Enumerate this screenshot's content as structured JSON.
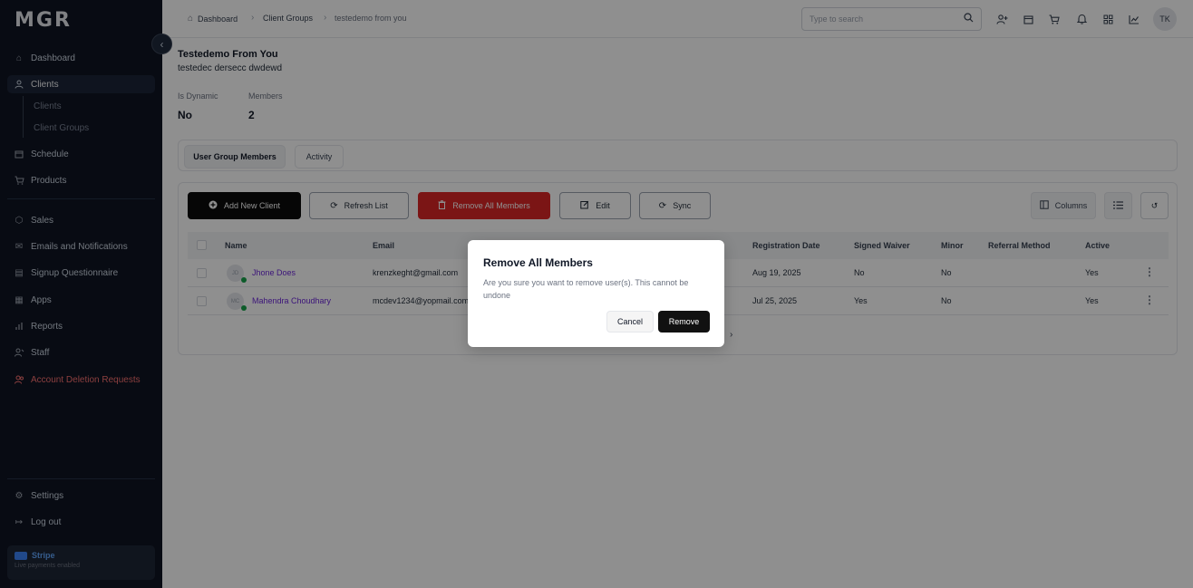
{
  "app": {
    "logo": "MGR"
  },
  "sidebar": {
    "items": [
      {
        "label": "Dashboard",
        "icon": "home-icon"
      },
      {
        "label": "Clients",
        "icon": "user-icon"
      },
      {
        "label": "Schedule",
        "icon": "calendar-icon"
      },
      {
        "label": "Products",
        "icon": "cart-icon"
      },
      {
        "label": "Sales",
        "icon": "box-icon"
      },
      {
        "label": "Emails and Notifications",
        "icon": "mail-icon"
      },
      {
        "label": "Signup Questionnaire",
        "icon": "form-icon"
      },
      {
        "label": "Apps",
        "icon": "apps-icon"
      },
      {
        "label": "Reports",
        "icon": "bar-chart-icon"
      },
      {
        "label": "Staff",
        "icon": "staff-icon"
      },
      {
        "label": "Account Deletion Requests",
        "icon": "users-icon"
      }
    ],
    "sub_items": [
      "Clients",
      "Client Groups"
    ],
    "bottom": [
      {
        "label": "Settings",
        "icon": "gear-icon"
      },
      {
        "label": "Log out",
        "icon": "logout-icon"
      }
    ],
    "stripe": {
      "title": "Stripe",
      "subtitle": "Live payments enabled"
    }
  },
  "topbar": {
    "breadcrumb": [
      "Dashboard",
      "Client Groups",
      "testedemo from you"
    ],
    "search_placeholder": "Type to search",
    "avatar_initials": "TK"
  },
  "group": {
    "title": "Testedemo From You",
    "description": "testedec dersecc dwdewd",
    "stats": [
      {
        "label": "Is Dynamic",
        "value": "No"
      },
      {
        "label": "Members",
        "value": "2"
      }
    ]
  },
  "tabs": [
    "User Group Members",
    "Activity"
  ],
  "toolbar": {
    "add": "Add New Client",
    "refresh": "Refresh List",
    "remove_all": "Remove All Members",
    "edit": "Edit",
    "sync": "Sync",
    "columns": "Columns"
  },
  "table": {
    "headers": [
      "Name",
      "Email",
      "Registration Date",
      "Signed Waiver",
      "Minor",
      "Referral Method",
      "Active"
    ],
    "rows": [
      {
        "initials": "JD",
        "name": "Jhone Does",
        "email": "krenzkeght@gmail.com",
        "registration": "Aug 19, 2025",
        "waiver": "No",
        "minor": "No",
        "referral": "",
        "active": "Yes"
      },
      {
        "initials": "MC",
        "name": "Mahendra Choudhary",
        "email": "mcdev1234@yopmail.com",
        "registration": "Jul 25, 2025",
        "waiver": "Yes",
        "minor": "No",
        "referral": "",
        "active": "Yes"
      }
    ]
  },
  "modal": {
    "title": "Remove All Members",
    "message": "Are you sure you want to remove user(s). This cannot be undone",
    "cancel": "Cancel",
    "confirm": "Remove"
  }
}
